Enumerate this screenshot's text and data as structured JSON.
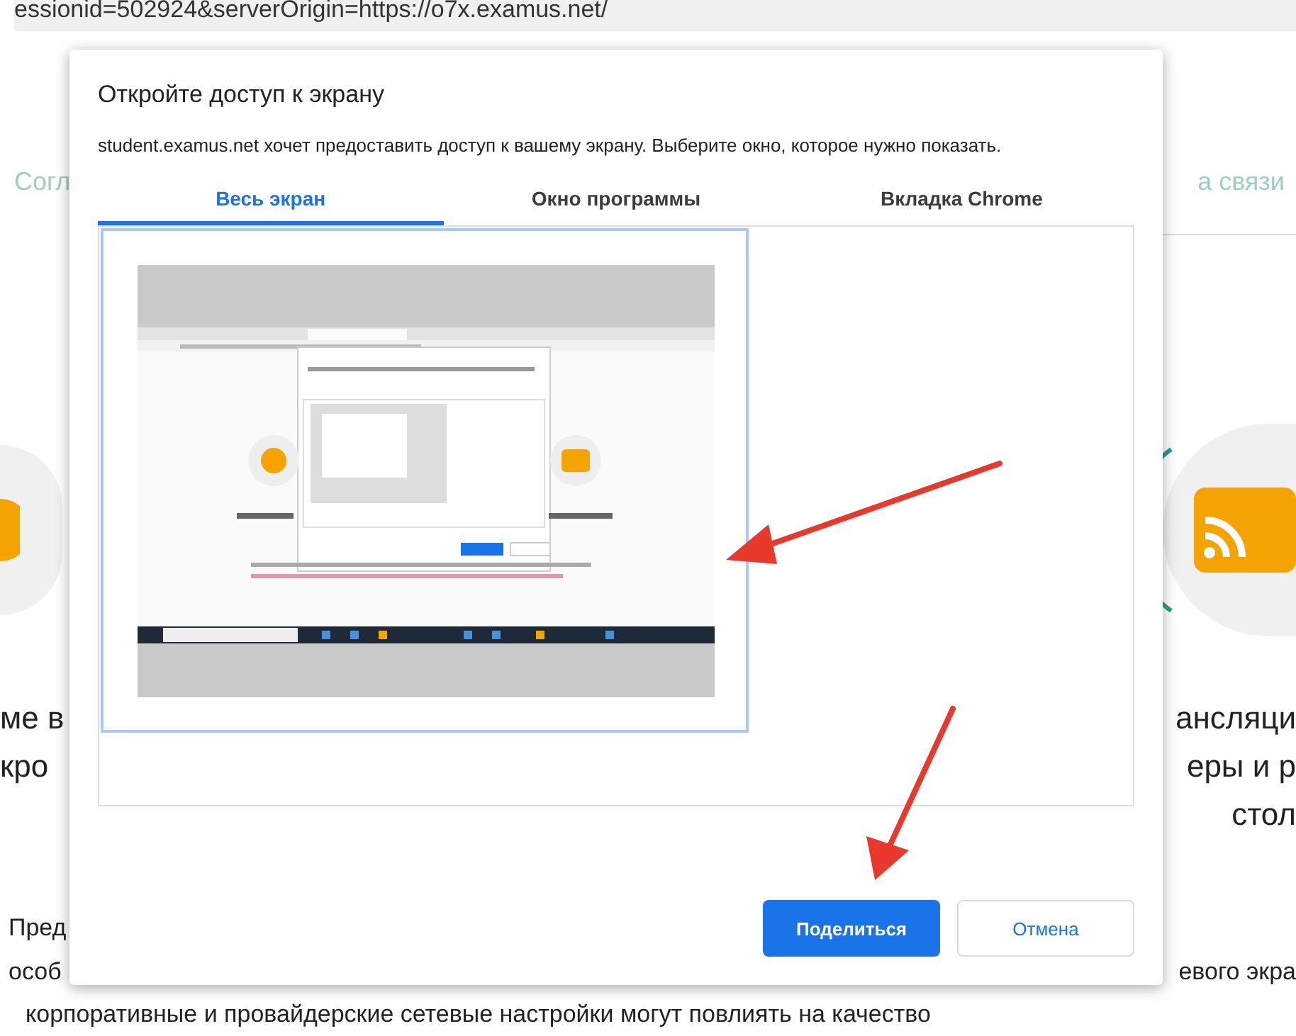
{
  "address_bar": {
    "url": "essionid=502924&serverOrigin=https://o7x.examus.net/"
  },
  "background_page": {
    "left_link": "Согл",
    "right_link": "а связи",
    "left_heading": [
      "ме в",
      "кро"
    ],
    "right_heading": [
      "ансляци",
      "еры и р",
      "стол"
    ],
    "paragraph_left": [
      "Пред",
      "особ"
    ],
    "paragraph_right": "евого экра",
    "bottom_line": "корпоративные и провайдерские сетевые настройки могут повлиять на качество"
  },
  "dialog": {
    "title": "Откройте доступ к экрану",
    "message": "student.examus.net хочет предоставить доступ к вашему экрану. Выберите окно, которое нужно показать.",
    "tabs": [
      {
        "label": "Весь экран",
        "selected": true
      },
      {
        "label": "Окно программы",
        "selected": false
      },
      {
        "label": "Вкладка Chrome",
        "selected": false
      }
    ],
    "sources": [
      {
        "kind": "screen",
        "selected": true
      }
    ],
    "buttons": [
      {
        "label": "Поделиться",
        "kind": "primary"
      },
      {
        "label": "Отмена",
        "kind": "secondary"
      }
    ]
  }
}
